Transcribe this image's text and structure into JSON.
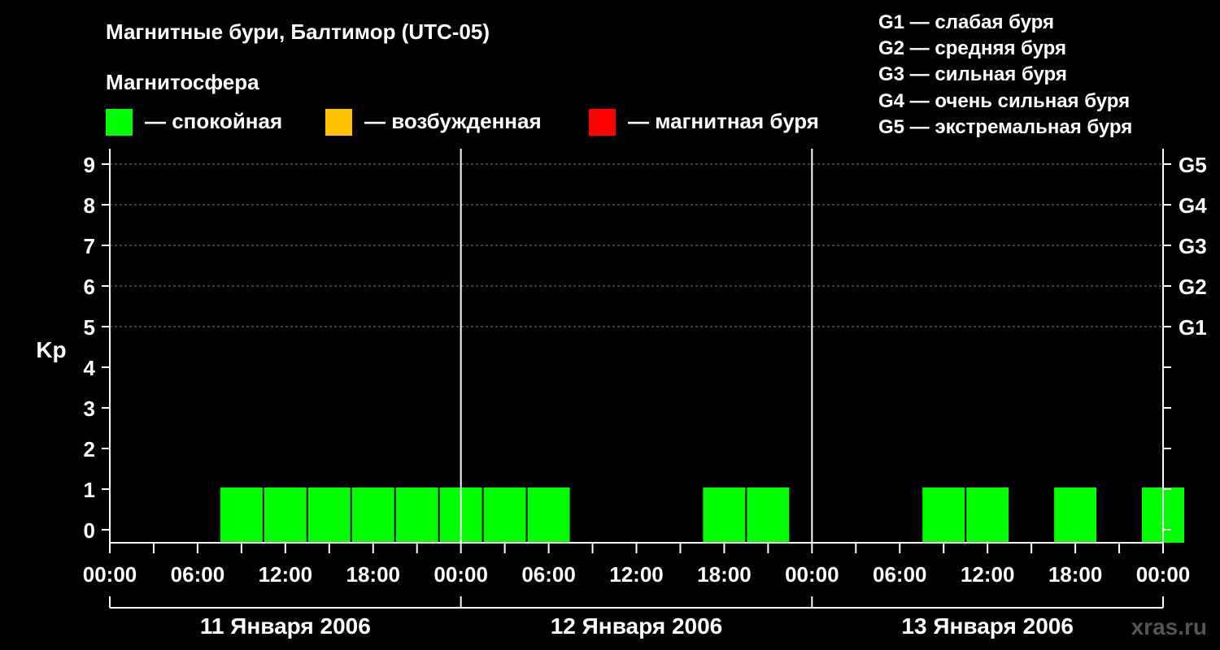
{
  "header": {
    "title": "Магнитные бури, Балтимор (UTC-05)",
    "subtitle": "Магнитосфера"
  },
  "legend": {
    "states": [
      {
        "label": "— спокойная",
        "color": "#00ff00"
      },
      {
        "label": "— возбужденная",
        "color": "#ffc000"
      },
      {
        "label": "— магнитная буря",
        "color": "#ff0000"
      }
    ],
    "storm_levels": [
      "G1 — слабая буря",
      "G2 — средняя буря",
      "G3 — сильная буря",
      "G4 — очень сильная буря",
      "G5 — экстремальная буря"
    ]
  },
  "site": "xras.ru",
  "chart_data": {
    "type": "bar",
    "ylabel": "Kp",
    "ylim": [
      0,
      9
    ],
    "y_ticks": [
      "0",
      "1",
      "2",
      "3",
      "4",
      "5",
      "6",
      "7",
      "8",
      "9"
    ],
    "right_ticks": [
      {
        "value": 5,
        "label": "G1"
      },
      {
        "value": 6,
        "label": "G2"
      },
      {
        "value": 7,
        "label": "G3"
      },
      {
        "value": 8,
        "label": "G4"
      },
      {
        "value": 9,
        "label": "G5"
      }
    ],
    "x_tick_labels": [
      "00:00",
      "06:00",
      "12:00",
      "18:00",
      "00:00",
      "06:00",
      "12:00",
      "18:00",
      "00:00",
      "06:00",
      "12:00",
      "18:00",
      "00:00"
    ],
    "days": [
      "11 Января 2006",
      "12 Января 2006",
      "13 Января 2006"
    ],
    "interval_hours": 3,
    "series": [
      {
        "color": "#00ff00",
        "bars": [
          {
            "start_hour": 7.5,
            "kp": 1
          },
          {
            "start_hour": 10.5,
            "kp": 1
          },
          {
            "start_hour": 13.5,
            "kp": 1
          },
          {
            "start_hour": 16.5,
            "kp": 1
          },
          {
            "start_hour": 19.5,
            "kp": 1
          },
          {
            "start_hour": 22.5,
            "kp": 1
          },
          {
            "start_hour": 25.5,
            "kp": 1
          },
          {
            "start_hour": 28.5,
            "kp": 1
          },
          {
            "start_hour": 40.5,
            "kp": 1
          },
          {
            "start_hour": 43.5,
            "kp": 1
          },
          {
            "start_hour": 55.5,
            "kp": 1
          },
          {
            "start_hour": 58.5,
            "kp": 1
          },
          {
            "start_hour": 64.5,
            "kp": 1
          },
          {
            "start_hour": 70.5,
            "kp": 1
          }
        ]
      }
    ],
    "grid": true
  }
}
